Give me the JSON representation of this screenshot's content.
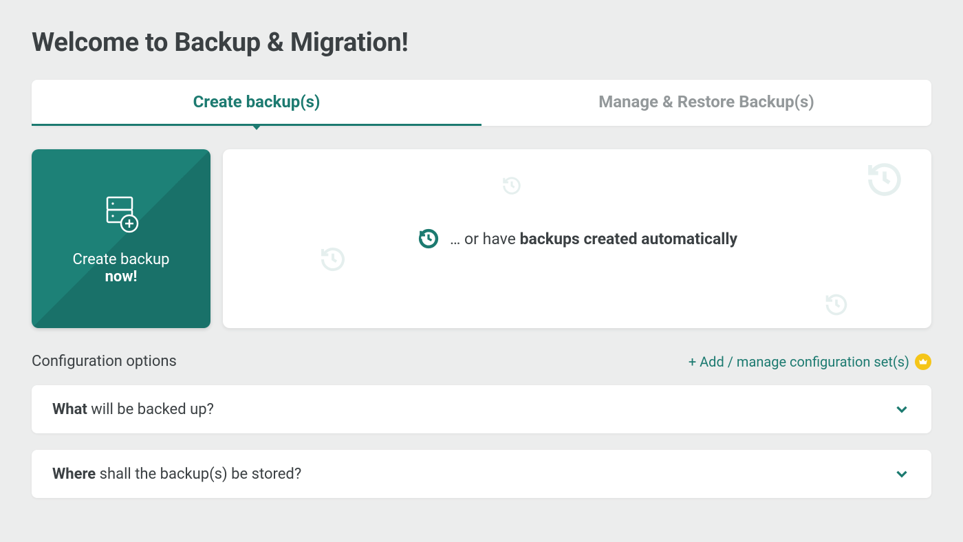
{
  "page_title": "Welcome to Backup & Migration!",
  "tabs": {
    "create": "Create backup(s)",
    "manage": "Manage & Restore Backup(s)"
  },
  "create_card": {
    "line1": "Create backup",
    "line2": "now!"
  },
  "auto_card": {
    "prefix": "… or have ",
    "bold": "backups created automatically"
  },
  "config": {
    "label": "Configuration options",
    "add_manage": "+ Add / manage configuration set(s)"
  },
  "accordions": {
    "what_bold": "What",
    "what_rest": " will be backed up?",
    "where_bold": "Where",
    "where_rest": " shall the backup(s) be stored?"
  }
}
